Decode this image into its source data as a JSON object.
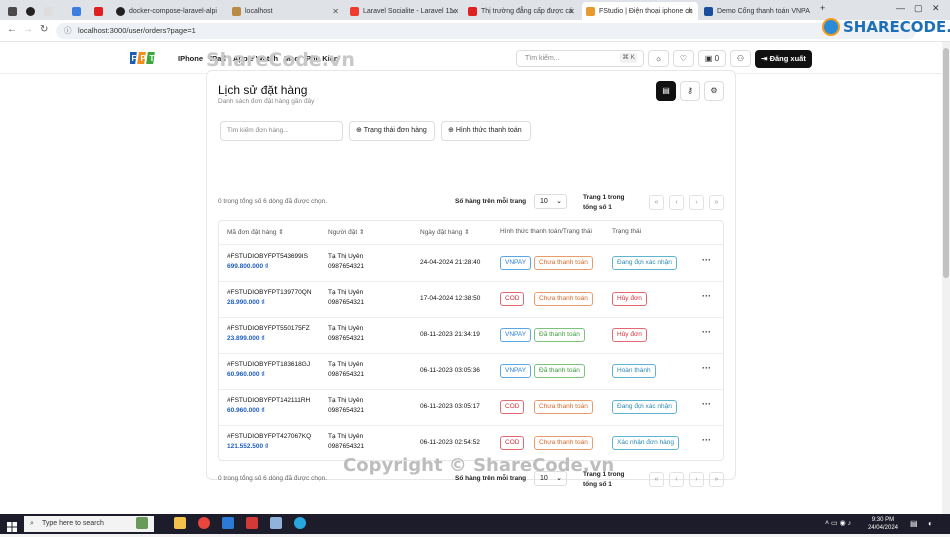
{
  "browser": {
    "tabs": [
      {
        "title": ""
      },
      {
        "title": ""
      },
      {
        "title": ""
      },
      {
        "title": ""
      },
      {
        "title": "docker-compose-laravel-alpi"
      },
      {
        "title": "localhost"
      },
      {
        "title": "Laravel Socialite - Laravel 11.x"
      },
      {
        "title": "Thị trường đẳng cấp được cá"
      },
      {
        "title": "FStudio | Điện thoại iphone ch"
      },
      {
        "title": "Demo Cổng thanh toán VNPA"
      }
    ],
    "new_tab": "+",
    "url": "localhost:3000/user/orders?page=1"
  },
  "header": {
    "menu": [
      "IPhone",
      "IPad",
      "Apple Watch",
      "Mac",
      "Phụ Kiện"
    ],
    "search_placeholder": "Tìm kiếm...",
    "search_shortcut": "⌘ K",
    "cart_count": "0",
    "logout": "Đăng xuất"
  },
  "watermark": {
    "top": "ShareCode.vn",
    "bottom": "Copyright © ShareCode.vn",
    "logo": "SHARECODE.vn"
  },
  "orders": {
    "title": "Lịch sử đặt hàng",
    "subtitle": "Danh sách đơn đặt hàng gần đây",
    "filter_placeholder": "Tìm kiếm đơn hàng...",
    "filter_status": "Trạng thái đơn hàng",
    "filter_payment": "Hình thức thanh toán",
    "selected_text": "0 trong tổng số 6 dòng đã được chọn.",
    "rows_per_page_label": "Số hàng trên mỗi trang",
    "rows_per_page": "10",
    "page_line1": "Trang 1 trong",
    "page_line2": "tổng số 1",
    "columns": [
      "Mã đơn đặt hàng",
      "Người đặt",
      "Ngày đặt hàng",
      "Hình thức thanh toán/Trạng thái",
      "Trạng thái"
    ],
    "rows": [
      {
        "code": "#FSTUDIOBYFPT543699IS",
        "price": "699.800.000 ₫",
        "name": "Tạ Thị Uyên",
        "phone": "0987654321",
        "date": "24-04-2024 21:28:40",
        "method": "VNPAY",
        "pay_status": "Chưa thanh toán",
        "status": "Đang đợi xác nhận"
      },
      {
        "code": "#FSTUDIOBYFPT139770QN",
        "price": "28.990.000 ₫",
        "name": "Tạ Thị Uyên",
        "phone": "0987654321",
        "date": "17-04-2024 12:38:50",
        "method": "COD",
        "pay_status": "Chưa thanh toán",
        "status": "Hủy đơn"
      },
      {
        "code": "#FSTUDIOBYFPT550175FZ",
        "price": "23.899.000 ₫",
        "name": "Tạ Thị Uyên",
        "phone": "0987654321",
        "date": "08-11-2023 21:34:19",
        "method": "VNPAY",
        "pay_status": "Đã thanh toán",
        "status": "Hủy đơn"
      },
      {
        "code": "#FSTUDIOBYFPT183618GJ",
        "price": "60.960.000 ₫",
        "name": "Tạ Thị Uyên",
        "phone": "0987654321",
        "date": "06-11-2023 03:05:36",
        "method": "VNPAY",
        "pay_status": "Đã thanh toán",
        "status": "Hoàn thành"
      },
      {
        "code": "#FSTUDIOBYFPT142111RH",
        "price": "60.960.000 ₫",
        "name": "Tạ Thị Uyên",
        "phone": "0987654321",
        "date": "06-11-2023 03:05:17",
        "method": "COD",
        "pay_status": "Chưa thanh toán",
        "status": "Đang đợi xác nhận"
      },
      {
        "code": "#FSTUDIOBYFPT427067KQ",
        "price": "121.552.500 ₫",
        "name": "Tạ Thị Uyên",
        "phone": "0987654321",
        "date": "06-11-2023 02:54:52",
        "method": "COD",
        "pay_status": "Chưa thanh toán",
        "status": "Xác nhận đơn hàng"
      }
    ]
  },
  "taskbar": {
    "search": "Type here to search",
    "time": "9:30 PM",
    "date": "24/04/2024"
  }
}
